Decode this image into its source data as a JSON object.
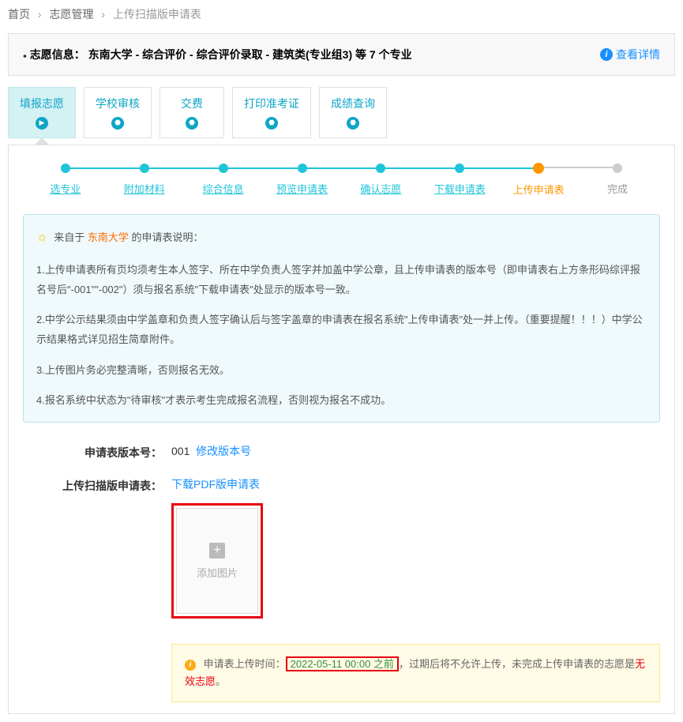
{
  "breadcrumb": {
    "home": "首页",
    "manage": "志愿管理",
    "current": "上传扫描版申请表"
  },
  "info_bar": {
    "prefix": "志愿信息：",
    "text": "东南大学 - 综合评价 - 综合评价录取 - 建筑类(专业组3) 等 7 个专业",
    "detail": "查看详情"
  },
  "tabs": [
    {
      "label": "填报志愿",
      "icon": "▶"
    },
    {
      "label": "学校审核",
      "icon": "⬣"
    },
    {
      "label": "交费",
      "icon": "⬣"
    },
    {
      "label": "打印准考证",
      "icon": "⬣"
    },
    {
      "label": "成绩查询",
      "icon": "⬣"
    }
  ],
  "steps": [
    {
      "label": "选专业"
    },
    {
      "label": "附加材料"
    },
    {
      "label": "综合信息"
    },
    {
      "label": "预览申请表"
    },
    {
      "label": "确认志愿"
    },
    {
      "label": "下载申请表"
    },
    {
      "label": "上传申请表"
    },
    {
      "label": "完成"
    }
  ],
  "notice": {
    "intro_pre": "来自于 ",
    "university": "东南大学",
    "intro_post": " 的申请表说明：",
    "p1": "1.上传申请表所有页均须考生本人签字、所在中学负责人签字并加盖中学公章，且上传申请表的版本号（即申请表右上方条形码综评报名号后\"-001\"\"-002\"）须与报名系统\"下载申请表\"处显示的版本号一致。",
    "p2": "2.中学公示结果须由中学盖章和负责人签字确认后与签字盖章的申请表在报名系统\"上传申请表\"处一并上传。（重要提醒！！！）中学公示结果格式详见招生简章附件。",
    "p3": "3.上传图片务必完整清晰，否则报名无效。",
    "p4": "4.报名系统中状态为\"待审核\"才表示考生完成报名流程，否则视为报名不成功。"
  },
  "version": {
    "label": "申请表版本号：",
    "value": "001",
    "edit": "修改版本号"
  },
  "upload": {
    "label": "上传扫描版申请表：",
    "download": "下载PDF版申请表",
    "add": "添加图片"
  },
  "warn": {
    "prefix": "申请表上传时间：",
    "deadline": "2022-05-11 00:00 之前",
    "mid": "，过期后将不允许上传，未完成上传申请表的志愿是",
    "invalid": "无效志愿",
    "suffix": "。"
  }
}
